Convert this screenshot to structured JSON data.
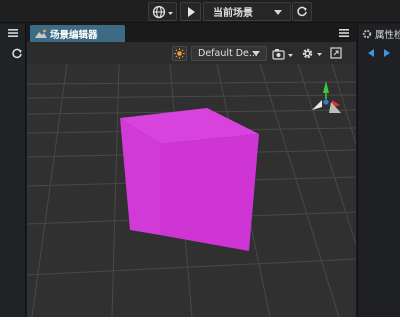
{
  "toolbar": {
    "scene_select": "当前场景"
  },
  "scene_editor": {
    "tab_label": "场景编辑器",
    "camera_preset": "Default De..."
  },
  "inspector": {
    "tab_label": "属性检"
  },
  "colors": {
    "accent_tab": "#3d6a84",
    "cube_front": "#d23ad8",
    "cube_right": "#bb25c1",
    "cube_top": "#d843de",
    "gizmo_y": "#3aca3a",
    "gizmo_x": "#e03030",
    "selection_blue": "#2f7fd8"
  },
  "icons": {
    "globe": "globe-icon",
    "play": "play-icon",
    "refresh": "refresh-icon",
    "menu": "menu-icon",
    "sun": "sun-icon",
    "camera": "camera-icon",
    "gear": "gear-icon",
    "maximize": "maximize-icon"
  }
}
